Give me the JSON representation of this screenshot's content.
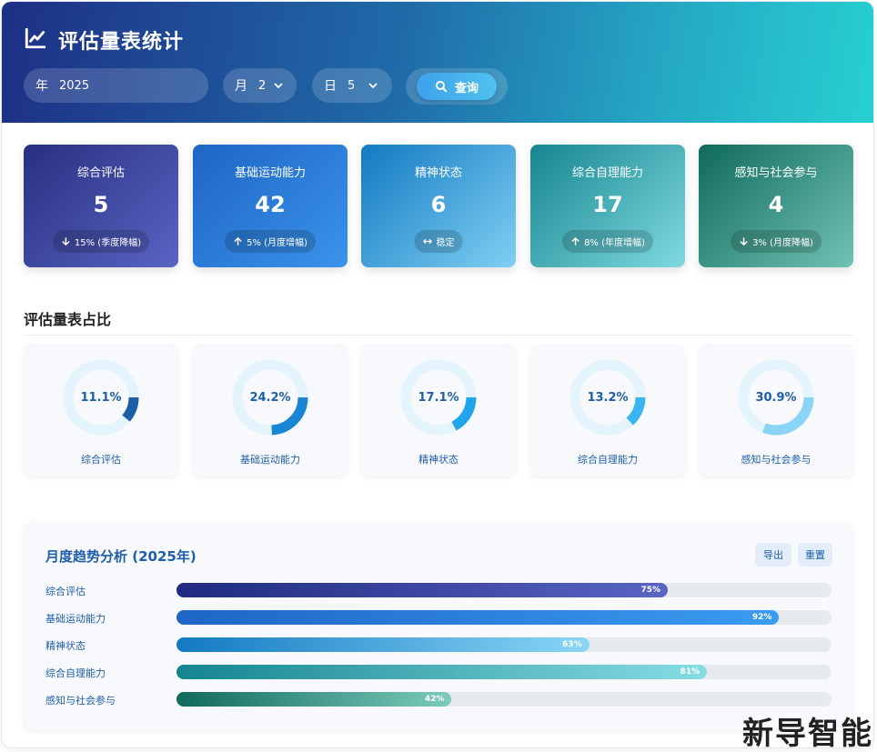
{
  "header": {
    "title": "评估量表统计",
    "icon": "line-chart-icon",
    "filters": {
      "year_label": "年",
      "year_value": "2025",
      "month_label": "月",
      "month_value": "2",
      "day_label": "日",
      "day_value": "5",
      "query_label": "查询"
    }
  },
  "stats": [
    {
      "title": "综合评估",
      "value": "5",
      "badge": "15% (季度降幅)",
      "trend": "down",
      "gradient": [
        "#27307f",
        "#5a64c3"
      ]
    },
    {
      "title": "基础运动能力",
      "value": "42",
      "badge": "5% (月度增幅)",
      "trend": "up",
      "gradient": [
        "#1e66c4",
        "#3a93ea"
      ]
    },
    {
      "title": "精神状态",
      "value": "6",
      "badge": "稳定",
      "trend": "flat",
      "gradient": [
        "#137ac2",
        "#7fcff2"
      ]
    },
    {
      "title": "综合自理能力",
      "value": "17",
      "badge": "8% (年度增幅)",
      "trend": "up",
      "gradient": [
        "#16858f",
        "#7fd9e0"
      ]
    },
    {
      "title": "感知与社会参与",
      "value": "4",
      "badge": "3% (月度降幅)",
      "trend": "down",
      "gradient": [
        "#0f6a5c",
        "#70c2b3"
      ]
    }
  ],
  "proportion": {
    "title": "评估量表占比",
    "items": [
      {
        "name": "综合评估",
        "pct_text": "11.1%",
        "pct": 11.1,
        "color": "#1c5fa6"
      },
      {
        "name": "基础运动能力",
        "pct_text": "24.2%",
        "pct": 24.2,
        "color": "#1a86d3"
      },
      {
        "name": "精神状态",
        "pct_text": "17.1%",
        "pct": 17.1,
        "color": "#21a4ea"
      },
      {
        "name": "综合自理能力",
        "pct_text": "13.2%",
        "pct": 13.2,
        "color": "#3bb5f0"
      },
      {
        "name": "感知与社会参与",
        "pct_text": "30.9%",
        "pct": 30.9,
        "color": "#8ad4f7"
      }
    ],
    "track_color": "#e3f4fd"
  },
  "trend": {
    "title": "月度趋势分析 (2025年)",
    "export_label": "导出",
    "reset_label": "重置",
    "rows": [
      {
        "name": "综合评估",
        "pct_text": "75%",
        "pct": 75,
        "gradient": [
          "#1f2a80",
          "#5a64c3"
        ]
      },
      {
        "name": "基础运动能力",
        "pct_text": "92%",
        "pct": 92,
        "gradient": [
          "#1e66c4",
          "#3a9cf0"
        ]
      },
      {
        "name": "精神状态",
        "pct_text": "63%",
        "pct": 63,
        "gradient": [
          "#137ac2",
          "#8ad6f6"
        ]
      },
      {
        "name": "综合自理能力",
        "pct_text": "81%",
        "pct": 81,
        "gradient": [
          "#14858f",
          "#88dde4"
        ]
      },
      {
        "name": "感知与社会参与",
        "pct_text": "42%",
        "pct": 42,
        "gradient": [
          "#0f6a5c",
          "#7ccbbc"
        ]
      }
    ]
  },
  "watermark": "新导智能"
}
